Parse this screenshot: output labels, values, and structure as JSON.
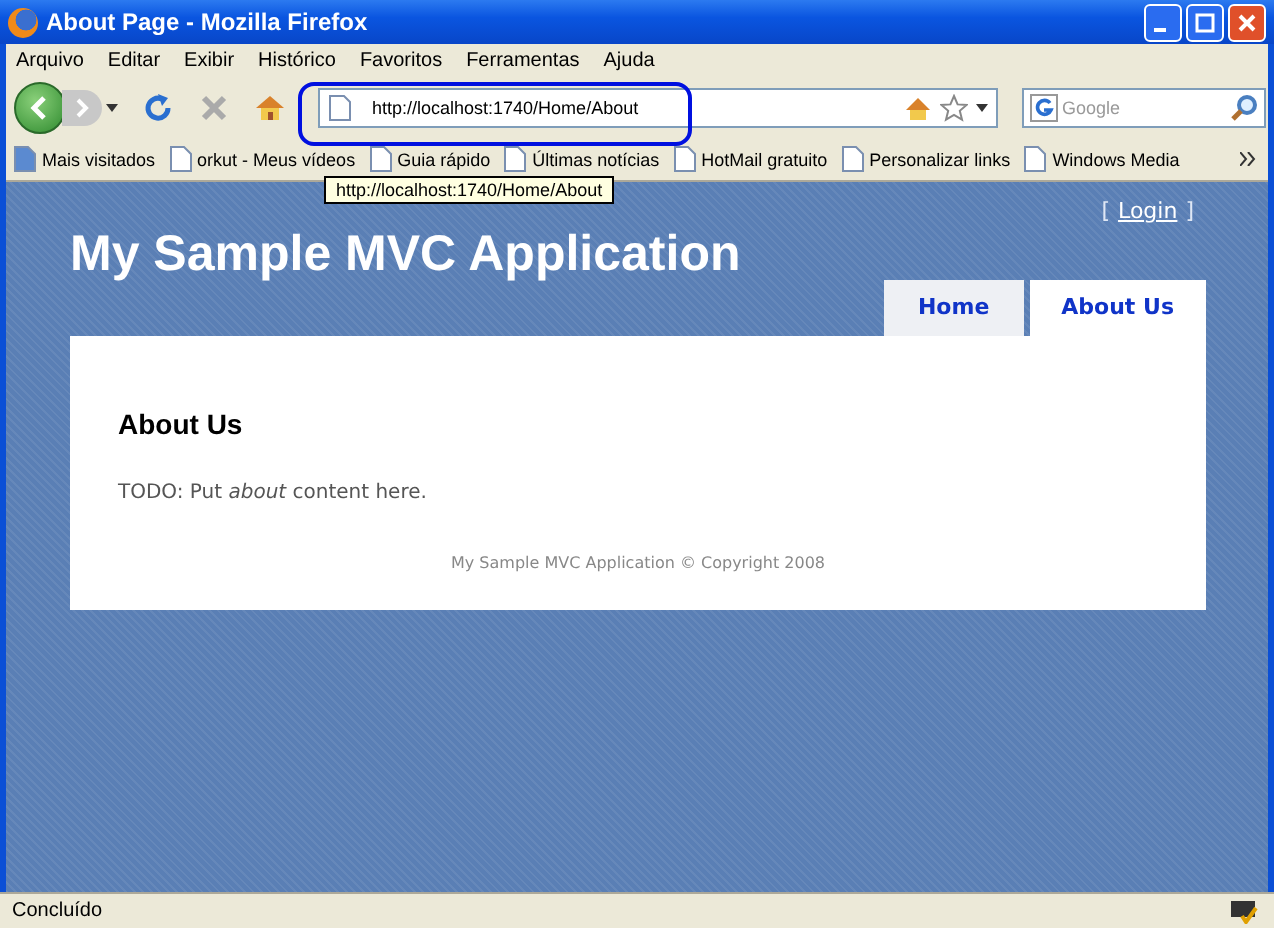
{
  "window": {
    "title": "About Page - Mozilla Firefox"
  },
  "menu": [
    "Arquivo",
    "Editar",
    "Exibir",
    "Histórico",
    "Favoritos",
    "Ferramentas",
    "Ajuda"
  ],
  "address_bar": {
    "value": "http://localhost:1740/Home/About"
  },
  "search": {
    "placeholder": "Google"
  },
  "bookmarks": [
    "Mais visitados",
    "orkut - Meus vídeos",
    "Guia rápido",
    "Últimas notícias",
    "HotMail gratuito",
    "Personalizar links",
    "Windows Media"
  ],
  "tooltip": "http://localhost:1740/Home/About",
  "page": {
    "login": {
      "open": "[",
      "link": "Login",
      "close": "]"
    },
    "site_title": "My Sample MVC Application",
    "tabs": [
      {
        "label": "Home",
        "selected": false
      },
      {
        "label": "About Us",
        "selected": true
      }
    ],
    "heading": "About Us",
    "body": "TODO: Put *about* content here.",
    "footer": "My Sample MVC Application © Copyright 2008"
  },
  "status_bar": "Concluído"
}
